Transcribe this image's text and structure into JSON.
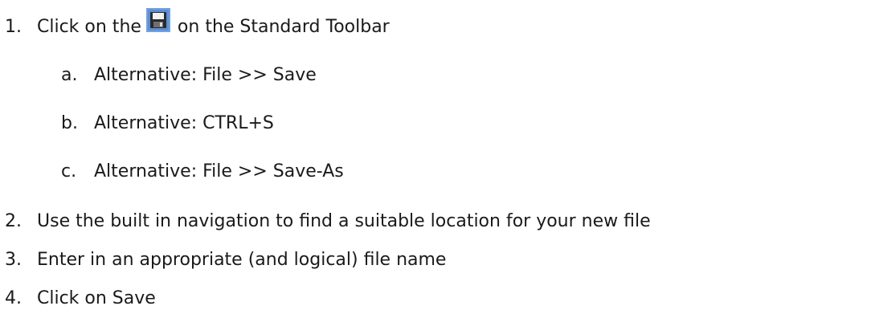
{
  "steps": [
    {
      "number": "1.",
      "before": "Click on the",
      "icon": "save-floppy-icon",
      "after": "on the Standard Toolbar",
      "substeps": [
        {
          "letter": "a.",
          "text": "Alternative: File >> Save"
        },
        {
          "letter": "b.",
          "text": "Alternative: CTRL+S"
        },
        {
          "letter": "c.",
          "text": "Alternative: File >> Save-As"
        }
      ]
    },
    {
      "number": "2.",
      "text": "Use the built in navigation to find a suitable location for your new file"
    },
    {
      "number": "3.",
      "text": "Enter in an appropriate (and logical) file name"
    },
    {
      "number": "4.",
      "text": "Click on Save"
    }
  ],
  "colors": {
    "text": "#1a1a1a",
    "icon_background": "#5b8fd6",
    "floppy_body": "#2b2b2b"
  }
}
